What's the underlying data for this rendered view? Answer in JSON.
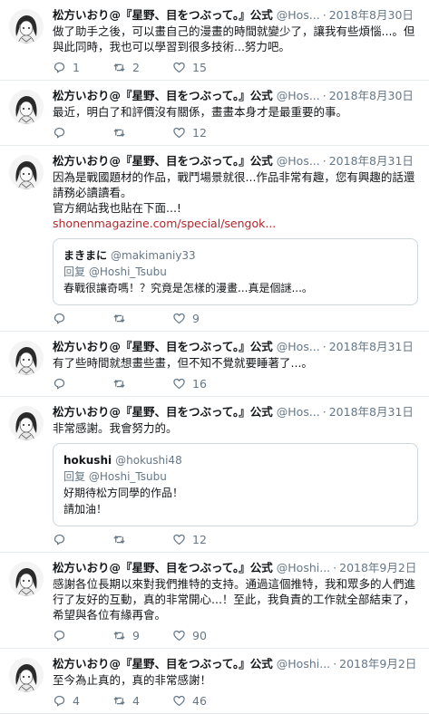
{
  "user": {
    "name": "松方いおり@『星野、目をつぶって。』公式",
    "handle_full": "@Hoshi_Tsubu"
  },
  "tweets": [
    {
      "handle": "@Hos...",
      "date": "2018年8月30日",
      "text": "做了助手之後，可以畫自己的漫畫的時間就變少了，讓我有些煩惱...。但與此同時，我也可以學習到很多技術...努力吧。",
      "reply": "1",
      "retweet": "2",
      "like": "15"
    },
    {
      "handle": "@Hos...",
      "date": "2018年8月30日",
      "text": "最近，明白了和評價沒有關係，畫畫本身才是最重要的事。",
      "reply": "",
      "retweet": "",
      "like": "12"
    },
    {
      "handle": "@Hos...",
      "date": "2018年8月31日",
      "text": "因為是戰國題材的作品，戰鬥場景就很...作品非常有趣，您有興趣的話還請務必讀讀看。\n官方網站我也貼在下面...!",
      "link": "shonenmagazine.com/special/sengok...",
      "quote": {
        "name": "まきまに",
        "handle": "@makimaniy33",
        "reply_prefix": "回复",
        "reply_to": "@Hoshi_Tsubu",
        "text": "春戰很讓奇嗎！？究竟是怎樣的漫畫...真是個謎...。"
      },
      "reply": "",
      "retweet": "",
      "like": "9"
    },
    {
      "handle": "@Hos...",
      "date": "2018年8月31日",
      "text": "有了些時間就想畫些畫，但不知不覺就要睡著了...。",
      "reply": "",
      "retweet": "",
      "like": "16"
    },
    {
      "handle": "@Hos...",
      "date": "2018年8月31日",
      "text": "非常感謝。我會努力的。",
      "quote": {
        "name": "hokushi",
        "handle": "@hokushi48",
        "reply_prefix": "回复",
        "reply_to": "@Hoshi_Tsubu",
        "text": "好期待松方同學的作品！\n請加油！"
      },
      "reply": "",
      "retweet": "",
      "like": "12"
    },
    {
      "handle": "@Hoshi...",
      "date": "2018年9月2日",
      "text": "感謝各位長期以來對我們推特的支持。通過這個推特，我和眾多的人們進行了友好的互動，真的非常開心...！至此，我負責的工作就全部結束了，希望與各位有緣再會。",
      "reply": "",
      "retweet": "9",
      "like": "90"
    },
    {
      "handle": "@Hoshi...",
      "date": "2018年9月2日",
      "text": "至今為止真的，真的非常感謝！",
      "reply": "4",
      "retweet": "4",
      "like": "46"
    }
  ],
  "icons": {
    "avatar": "avatar-illustration-icon",
    "reply": "reply-icon",
    "retweet": "retweet-icon",
    "like": "heart-icon"
  },
  "colors": {
    "link": "#b4252a",
    "muted": "#657786",
    "border": "#e6ecf0"
  }
}
